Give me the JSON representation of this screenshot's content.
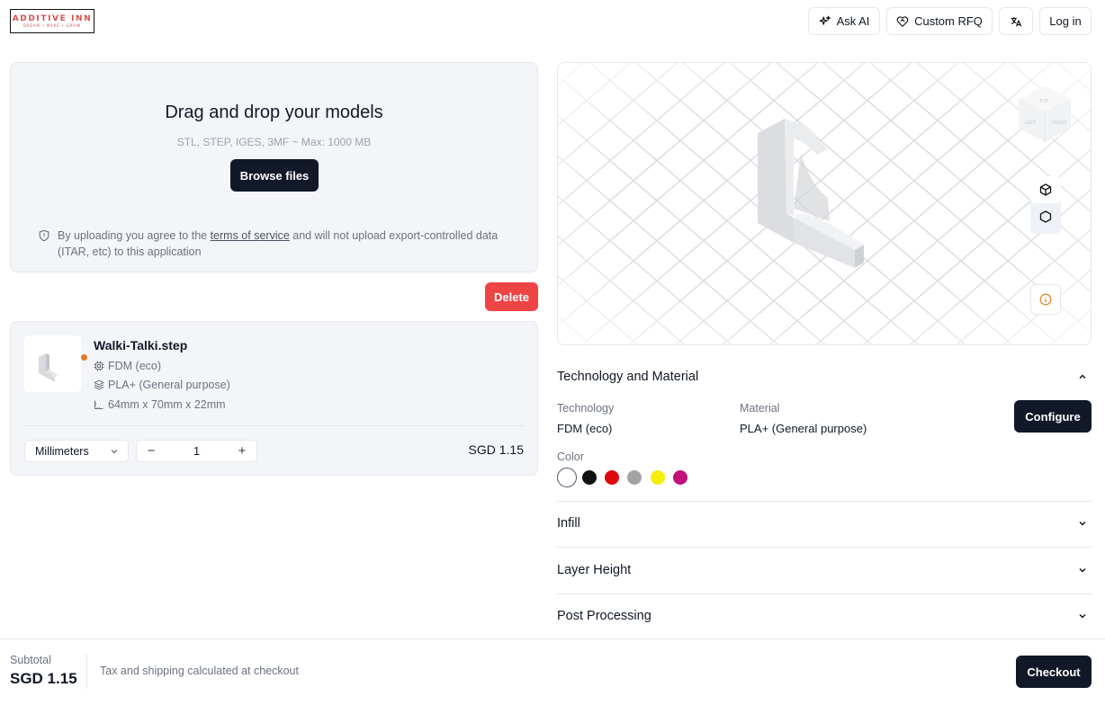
{
  "brand": {
    "name": "ADDITIVE INN",
    "tagline": "DREAM • MAKE • GROW"
  },
  "header": {
    "ask_ai": "Ask AI",
    "custom_rfq": "Custom RFQ",
    "login": "Log in"
  },
  "upload": {
    "title": "Drag and drop your models",
    "formats": "STL, STEP, IGES, 3MF ~ Max: 1000 MB",
    "browse_label": "Browse files",
    "notice_before": "By uploading you agree to the ",
    "notice_link": "terms of service",
    "notice_after": " and will not upload export-controlled data (ITAR, etc) to this application"
  },
  "actions": {
    "delete_label": "Delete"
  },
  "part": {
    "file_name": "Walki-Talki.step",
    "technology": "FDM (eco)",
    "material": "PLA+ (General purpose)",
    "dimensions": "64mm x 70mm x 22mm",
    "unit": "Millimeters",
    "quantity": "1",
    "price": "SGD 1.15",
    "status_color": "#e07b2a"
  },
  "viewer": {
    "cube_faces": {
      "top": "TOP",
      "front": "FRONT",
      "left": "LEFT"
    },
    "tools": [
      "cube-solid-icon",
      "hexagon-icon"
    ],
    "info_icon": "info-icon"
  },
  "config": {
    "section_title": "Technology and Material",
    "technology_label": "Technology",
    "technology_value": "FDM (eco)",
    "material_label": "Material",
    "material_value": "PLA+ (General purpose)",
    "configure_label": "Configure",
    "color_label": "Color",
    "colors": [
      "#ffffff",
      "#111111",
      "#e0080f",
      "#a3a3a3",
      "#f5ee0b",
      "#c2117c"
    ],
    "sections": [
      "Infill",
      "Layer Height",
      "Post Processing"
    ]
  },
  "footer": {
    "subtotal_label": "Subtotal",
    "subtotal_value": "SGD 1.15",
    "tax_note": "Tax and shipping calculated at checkout",
    "checkout_label": "Checkout"
  }
}
